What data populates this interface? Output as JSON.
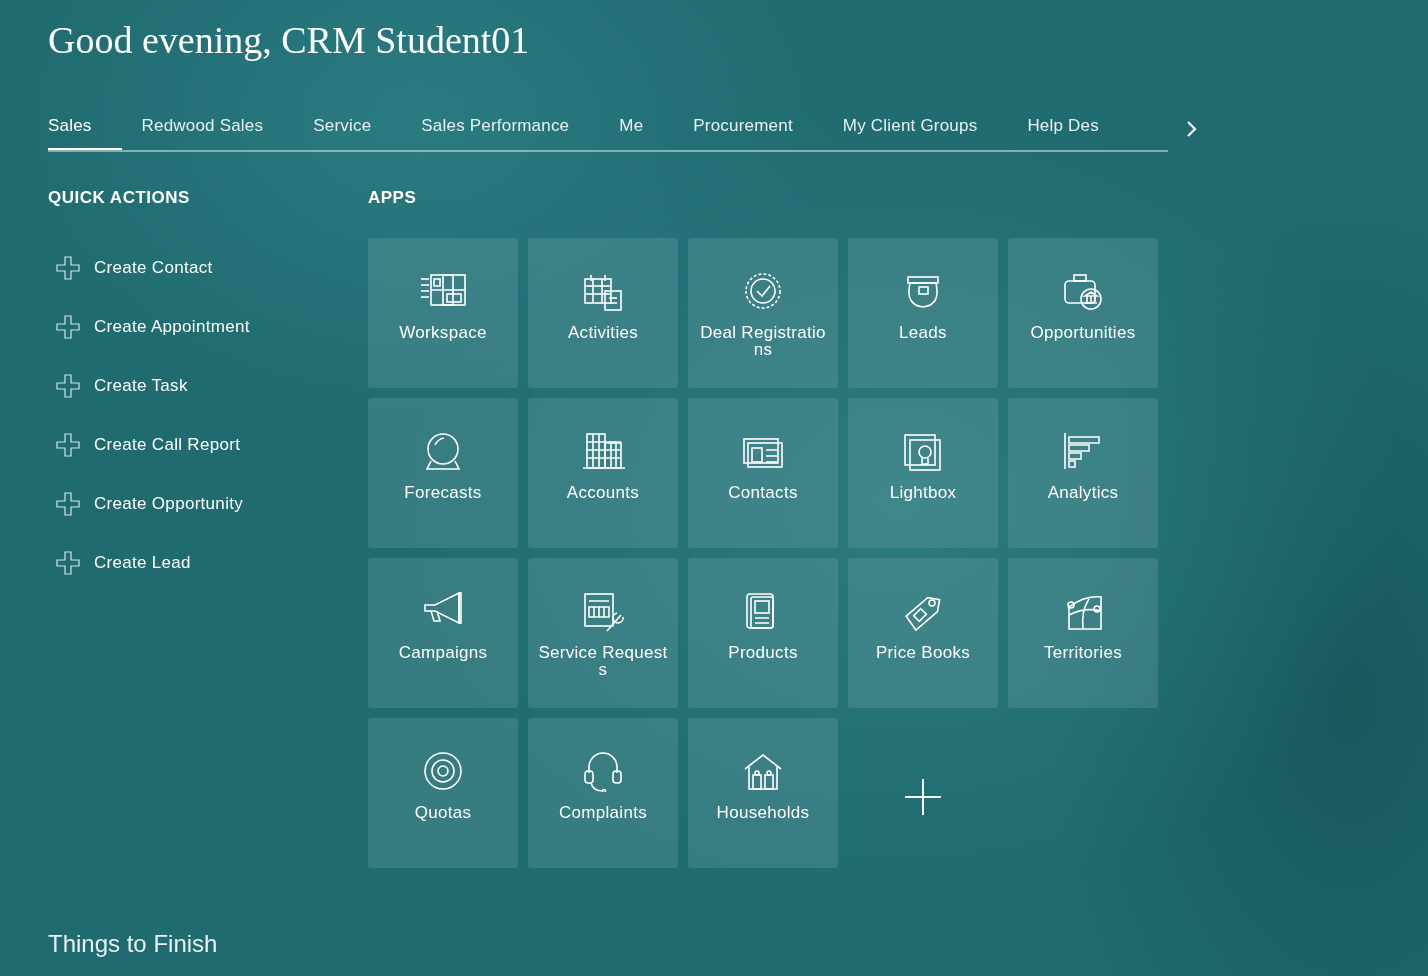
{
  "greeting": "Good evening, CRM Student01",
  "tabs": [
    {
      "label": "Sales",
      "selected": true
    },
    {
      "label": "Redwood Sales",
      "selected": false
    },
    {
      "label": "Service",
      "selected": false
    },
    {
      "label": "Sales Performance",
      "selected": false
    },
    {
      "label": "Me",
      "selected": false
    },
    {
      "label": "Procurement",
      "selected": false
    },
    {
      "label": "My Client Groups",
      "selected": false
    },
    {
      "label": "Help Des",
      "selected": false
    }
  ],
  "quick_actions": {
    "title": "QUICK ACTIONS",
    "items": [
      "Create Contact",
      "Create Appointment",
      "Create Task",
      "Create Call Report",
      "Create Opportunity",
      "Create Lead"
    ]
  },
  "apps": {
    "title": "APPS",
    "items": [
      {
        "label": "Workspace",
        "kind": "workspace"
      },
      {
        "label": "Activities",
        "kind": "calendar"
      },
      {
        "label": "Deal Registrations",
        "kind": "seal"
      },
      {
        "label": "Leads",
        "kind": "pot"
      },
      {
        "label": "Opportunities",
        "kind": "briefcase"
      },
      {
        "label": "Forecasts",
        "kind": "globe"
      },
      {
        "label": "Accounts",
        "kind": "building"
      },
      {
        "label": "Contacts",
        "kind": "card"
      },
      {
        "label": "Lightbox",
        "kind": "bulb"
      },
      {
        "label": "Analytics",
        "kind": "bars"
      },
      {
        "label": "Campaigns",
        "kind": "megaphone"
      },
      {
        "label": "Service Requests",
        "kind": "wrench"
      },
      {
        "label": "Products",
        "kind": "book"
      },
      {
        "label": "Price Books",
        "kind": "tag"
      },
      {
        "label": "Territories",
        "kind": "map"
      },
      {
        "label": "Quotas",
        "kind": "target"
      },
      {
        "label": "Complaints",
        "kind": "headset"
      },
      {
        "label": "Households",
        "kind": "house"
      }
    ]
  },
  "section_title": "Things to Finish"
}
